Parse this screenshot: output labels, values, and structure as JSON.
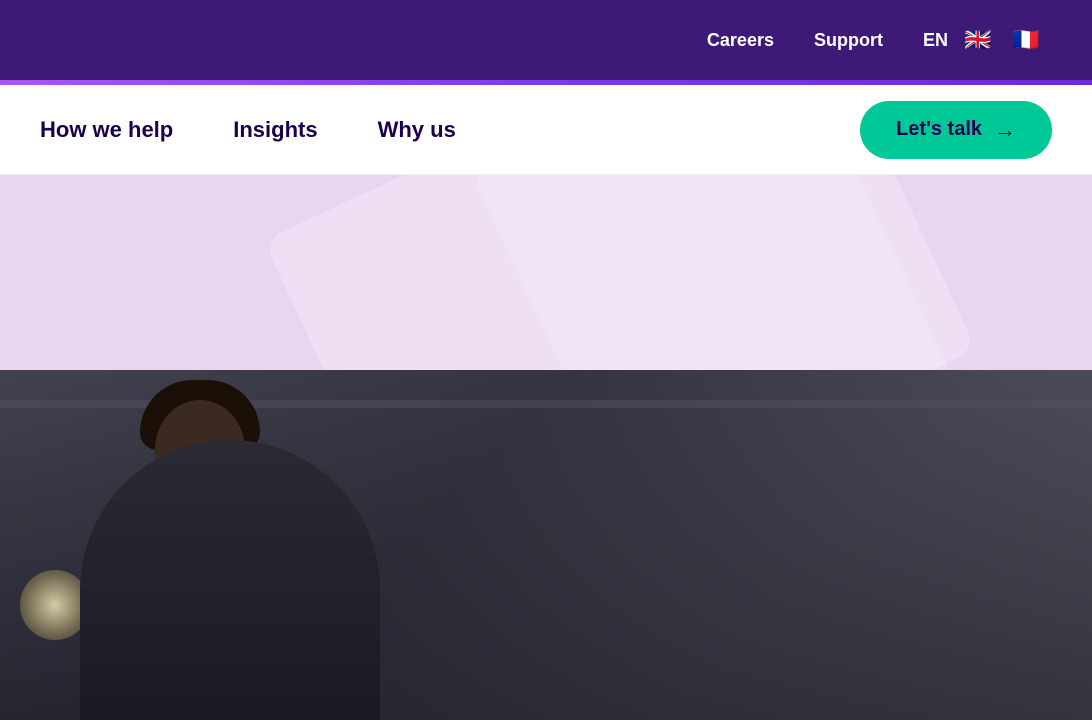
{
  "topbar": {
    "careers_label": "Careers",
    "support_label": "Support",
    "lang_label": "EN",
    "flag_uk": "🇬🇧",
    "flag_fr": "🇫🇷"
  },
  "mainnav": {
    "how_we_help": "How we help",
    "insights": "Insights",
    "why_us": "Why us",
    "cta_label": "Let's talk",
    "cta_arrow": "→"
  },
  "colors": {
    "topbar_bg": "#3d1a78",
    "cta_bg": "#00c896",
    "hero_bg": "#e8d5f0",
    "nav_text": "#1a0050"
  }
}
